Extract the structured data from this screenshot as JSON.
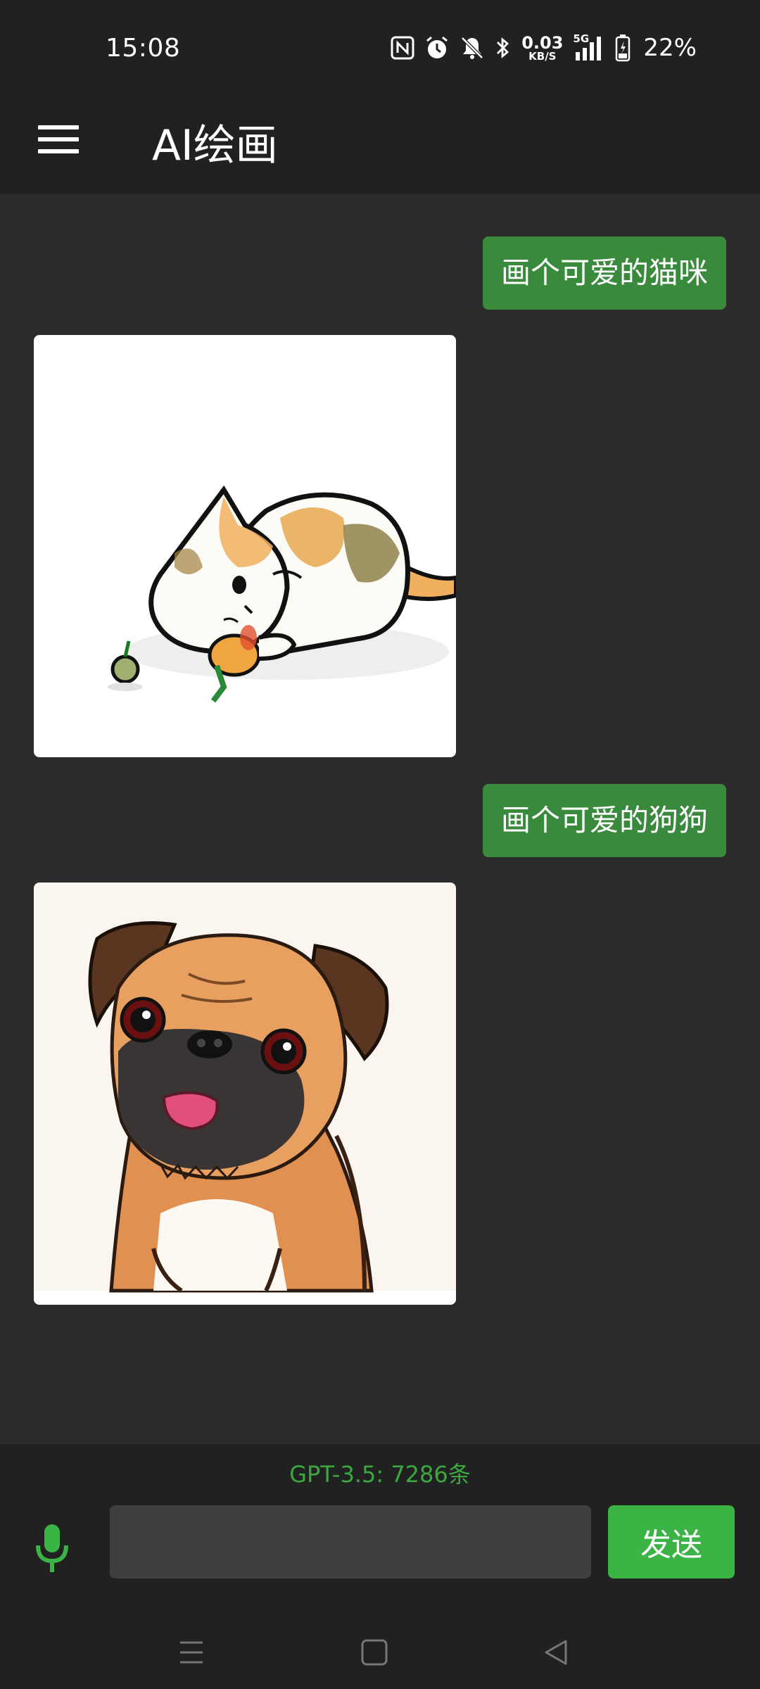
{
  "status_bar": {
    "time": "15:08",
    "net_speed_value": "0.03",
    "net_speed_unit": "KB/S",
    "network": "5G",
    "battery": "22%",
    "icons": [
      "nfc-icon",
      "alarm-icon",
      "mute-icon",
      "bluetooth-icon",
      "signal-icon",
      "battery-icon"
    ]
  },
  "app_bar": {
    "title": "AI绘画",
    "menu_icon": "hamburger-menu-icon"
  },
  "messages": [
    {
      "role": "user",
      "text": "画个可爱的猫咪"
    },
    {
      "role": "assistant",
      "type": "image",
      "subject": "cat"
    },
    {
      "role": "user",
      "text": "画个可爱的狗狗"
    },
    {
      "role": "assistant",
      "type": "image",
      "subject": "pug"
    }
  ],
  "composer": {
    "usage": "GPT-3.5: 7286条",
    "input_value": "",
    "send_label": "发送",
    "mic_icon": "microphone-icon"
  },
  "colors": {
    "accent": "#3bb345",
    "bubble": "#3a8a3e",
    "background": "#2b2b2b",
    "bar": "#212121"
  }
}
